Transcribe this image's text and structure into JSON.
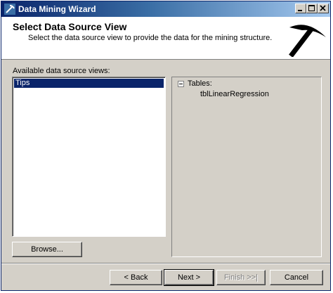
{
  "window": {
    "title": "Data Mining Wizard",
    "accent_color": "#0a246a",
    "controls": [
      "minimize-icon",
      "maximize-icon",
      "close-icon"
    ]
  },
  "header": {
    "title": "Select Data Source View",
    "description": "Select the data source view to provide the data for the mining structure.",
    "graphic": "pickaxe-icon"
  },
  "sources": {
    "label": "Available data source views:",
    "items": [
      "Tips"
    ],
    "selected": "Tips"
  },
  "tree": {
    "root_label": "Tables:",
    "children": [
      "tblLinearRegression"
    ]
  },
  "buttons": {
    "browse": "Browse...",
    "back": "< Back",
    "next": "Next >",
    "finish": "Finish >>|",
    "cancel": "Cancel"
  }
}
